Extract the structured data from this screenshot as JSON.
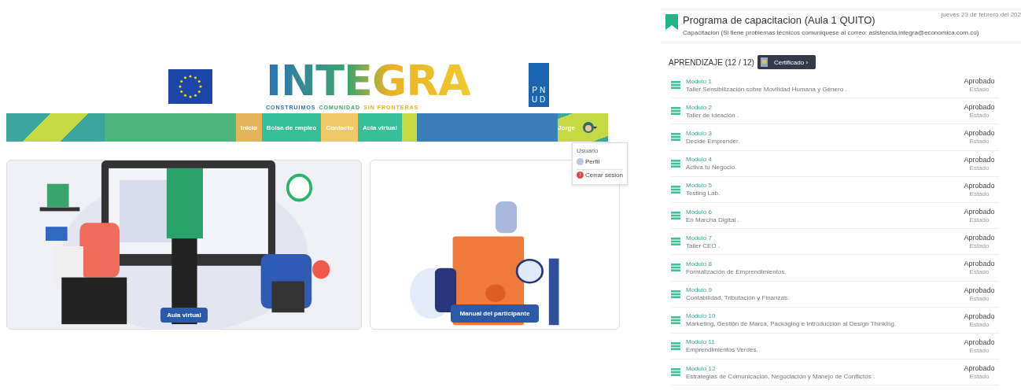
{
  "site": {
    "logo": {
      "word": "INTEGRA",
      "tagline_parts": [
        {
          "text": "CONSTRUIMOS",
          "color": "#2f6fb3"
        },
        {
          "text": "COMUNIDAD",
          "color": "#3aa56b"
        },
        {
          "text": "SIN FRONTERAS",
          "color": "#e7b21f"
        }
      ]
    },
    "partner_letters": [
      "P",
      "N",
      "U",
      "D"
    ],
    "nav": [
      {
        "label": "Inicio",
        "color": "#e4b45a"
      },
      {
        "label": "Bolsa de empleo",
        "color": "#38bf98"
      },
      {
        "label": "Contacto",
        "color": "#f0c866"
      },
      {
        "label": "Aula virtual",
        "color": "#38bf98"
      }
    ],
    "user": {
      "name": "Jorge"
    },
    "user_menu": {
      "heading": "Usuario",
      "items": [
        {
          "label": "Perfil",
          "kind": "profile"
        },
        {
          "label": "Cerrar sesion",
          "kind": "logout"
        }
      ]
    },
    "cards": [
      {
        "button": "Aula virtual",
        "kind": "classroom"
      },
      {
        "button": "Manual del participante",
        "kind": "manual"
      }
    ]
  },
  "course": {
    "title": "Programa de capacitacion (Aula 1 QUITO)",
    "subtitle": "Capacitacion (Si tiene problemas técnicos comuniquese al correo: asistencia.integra@economica.com.co)",
    "date": "jueves 23 de febrero del 202",
    "section": "APRENDIZAJE (12 / 12)",
    "certificate": "Certificado ›",
    "modules": [
      {
        "name": "Modulo 1",
        "description": "Taller Sensibilización sobre Movilidad Humana y Género .",
        "status": "Aprobado",
        "status_label": "Estado"
      },
      {
        "name": "Modulo 2",
        "description": "Taller de Ideación .",
        "status": "Aprobado",
        "status_label": "Estado"
      },
      {
        "name": "Modulo 3",
        "description": "Decide Emprender.",
        "status": "Aprobado",
        "status_label": "Estado"
      },
      {
        "name": "Modulo 4",
        "description": "Activa tu Negocio.",
        "status": "Aprobado",
        "status_label": "Estado"
      },
      {
        "name": "Modulo 5",
        "description": "Testing Lab.",
        "status": "Aprobado",
        "status_label": "Estado"
      },
      {
        "name": "Modulo 6",
        "description": "En Marcha Digital .",
        "status": "Aprobado",
        "status_label": "Estado"
      },
      {
        "name": "Modulo 7",
        "description": "Taller CEO .",
        "status": "Aprobado",
        "status_label": "Estado"
      },
      {
        "name": "Modulo 8",
        "description": "Formalización de Emprendimientos.",
        "status": "Aprobado",
        "status_label": "Estado"
      },
      {
        "name": "Modulo 9",
        "description": "Contabilidad, Tributación y Finanzas.",
        "status": "Aprobado",
        "status_label": "Estado"
      },
      {
        "name": "Modulo 10",
        "description": "Marketing, Gestión de Marca, Packaging e Introducción al Design Thinking.",
        "status": "Aprobado",
        "status_label": "Estado"
      },
      {
        "name": "Modulo 11",
        "description": "Emprendimientos Verdes.",
        "status": "Aprobado",
        "status_label": "Estado"
      },
      {
        "name": "Modulo 12",
        "description": "Estrategias de Comunicación, Negociación y Manejo de Conflictos .",
        "status": "Aprobado",
        "status_label": "Estado"
      }
    ]
  }
}
